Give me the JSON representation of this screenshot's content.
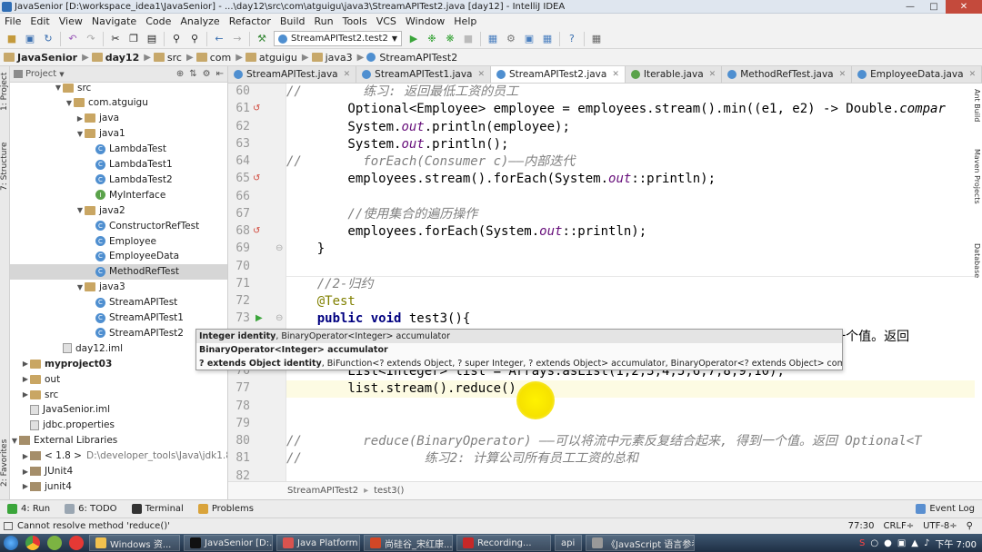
{
  "window": {
    "title": "JavaSenior [D:\\workspace_idea1\\JavaSenior] - ...\\day12\\src\\com\\atguigu\\java3\\StreamAPITest2.java [day12] - IntelliJ IDEA"
  },
  "menu": [
    "File",
    "Edit",
    "View",
    "Navigate",
    "Code",
    "Analyze",
    "Refactor",
    "Build",
    "Run",
    "Tools",
    "VCS",
    "Window",
    "Help"
  ],
  "toolbar": {
    "run_config": "StreamAPITest2.test2"
  },
  "breadcrumbs": [
    "JavaSenior",
    "day12",
    "src",
    "com",
    "atguigu",
    "java3",
    "StreamAPITest2"
  ],
  "project_panel": {
    "title": "Project",
    "tree": [
      {
        "label": "src",
        "level": 5
      },
      {
        "label": "com.atguigu",
        "level": 6
      },
      {
        "label": "java",
        "level": 7
      },
      {
        "label": "java1",
        "level": 7
      },
      {
        "label": "LambdaTest",
        "level": 8,
        "kind": "class"
      },
      {
        "label": "LambdaTest1",
        "level": 8,
        "kind": "class"
      },
      {
        "label": "LambdaTest2",
        "level": 8,
        "kind": "class"
      },
      {
        "label": "MyInterface",
        "level": 8,
        "kind": "interface"
      },
      {
        "label": "java2",
        "level": 7
      },
      {
        "label": "ConstructorRefTest",
        "level": 8,
        "kind": "class"
      },
      {
        "label": "Employee",
        "level": 8,
        "kind": "class"
      },
      {
        "label": "EmployeeData",
        "level": 8,
        "kind": "class"
      },
      {
        "label": "MethodRefTest",
        "level": 8,
        "kind": "class",
        "selected": true
      },
      {
        "label": "java3",
        "level": 7
      },
      {
        "label": "StreamAPITest",
        "level": 8,
        "kind": "class"
      },
      {
        "label": "StreamAPITest1",
        "level": 8,
        "kind": "class"
      },
      {
        "label": "StreamAPITest2",
        "level": 8,
        "kind": "class"
      },
      {
        "label": "day12.iml",
        "level": 5,
        "kind": "iml"
      },
      {
        "label": "myproject03",
        "level": 2,
        "kind": "module"
      },
      {
        "label": "out",
        "level": 2,
        "kind": "folder"
      },
      {
        "label": "src",
        "level": 2,
        "kind": "folder"
      },
      {
        "label": "JavaSenior.iml",
        "level": 2,
        "kind": "iml"
      },
      {
        "label": "jdbc.properties",
        "level": 2,
        "kind": "props"
      },
      {
        "label": "External Libraries",
        "level": 1,
        "kind": "lib"
      },
      {
        "label": "< 1.8 >",
        "level": 2,
        "kind": "lib",
        "path": "D:\\developer_tools\\Java\\jdk1.8.0"
      },
      {
        "label": "JUnit4",
        "level": 2,
        "kind": "lib"
      },
      {
        "label": "junit4",
        "level": 2,
        "kind": "lib"
      }
    ]
  },
  "editor_tabs": [
    {
      "label": "StreamAPITest.java"
    },
    {
      "label": "StreamAPITest1.java"
    },
    {
      "label": "StreamAPITest2.java",
      "active": true
    },
    {
      "label": "Iterable.java"
    },
    {
      "label": "MethodRefTest.java"
    },
    {
      "label": "EmployeeData.java"
    }
  ],
  "code_lines": [
    {
      "n": "60",
      "text": "//        练习: 返回最低工资的员工"
    },
    {
      "n": "61",
      "text": "        Optional<Employee> employee = employees.stream().min((e1, e2) -> Double.compar"
    },
    {
      "n": "62",
      "text": "        System.out.println(employee);"
    },
    {
      "n": "63",
      "text": "        System.out.println();"
    },
    {
      "n": "64",
      "text": "//        forEach(Consumer c)——内部迭代"
    },
    {
      "n": "65",
      "text": "        employees.stream().forEach(System.out::println);"
    },
    {
      "n": "66",
      "text": ""
    },
    {
      "n": "67",
      "text": "        //使用集合的遍历操作"
    },
    {
      "n": "68",
      "text": "        employees.forEach(System.out::println);"
    },
    {
      "n": "69",
      "text": "    }"
    },
    {
      "n": "70",
      "text": ""
    },
    {
      "n": "71",
      "text": "    //2-归约"
    },
    {
      "n": "72",
      "text": "    @Test"
    },
    {
      "n": "73",
      "text": "    public void test3(){"
    },
    {
      "n": "74",
      "text": "                                                                  , 得到一个值。返回"
    },
    {
      "n": "75",
      "text": ""
    },
    {
      "n": "76",
      "text": "        List<Integer> list = Arrays.asList(1,2,3,4,5,6,7,8,9,10);"
    },
    {
      "n": "77",
      "text": "        list.stream().reduce()"
    },
    {
      "n": "78",
      "text": ""
    },
    {
      "n": "79",
      "text": ""
    },
    {
      "n": "80",
      "text": "//        reduce(BinaryOperator) ——可以将流中元素反复结合起来, 得到一个值。返回 Optional<T"
    },
    {
      "n": "81",
      "text": "//                练习2: 计算公司所有员工工资的总和"
    },
    {
      "n": "82",
      "text": ""
    }
  ],
  "completion_popup": [
    {
      "bold": "Integer identity",
      "rest": ", BinaryOperator<Integer> accumulator"
    },
    {
      "bold": "BinaryOperator<Integer> accumulator",
      "rest": ""
    },
    {
      "bold": "? extends Object identity",
      "rest": ", BiFunction<? extends Object, ? super Integer, ? extends Object> accumulator, BinaryOperator<? extends Object> combiner"
    }
  ],
  "editor_breadcrumb": [
    "StreamAPITest2",
    "test3()"
  ],
  "bottom_tabs": [
    {
      "label": "4: Run"
    },
    {
      "label": "6: TODO"
    },
    {
      "label": "Terminal"
    },
    {
      "label": "Problems"
    }
  ],
  "event_log": "Event Log",
  "status": {
    "message": "Cannot resolve method 'reduce()'",
    "position": "77:30",
    "line_sep": "CRLF÷",
    "encoding": "UTF-8÷"
  },
  "ime": "英",
  "side_labels": {
    "project": "1: Project",
    "structure": "7: Structure",
    "favorites": "2: Favorites",
    "ant": "Ant Build",
    "maven": "Maven Projects",
    "database": "Database"
  },
  "taskbar": {
    "items": [
      "Windows 资...",
      "JavaSenior [D:...",
      "Java Platform ...",
      "尚硅谷_宋红康...",
      "Recording...",
      "api",
      "《JavaScript 语言参考..."
    ],
    "time": "下午 7:00"
  },
  "colors": {
    "comment": "#808080",
    "keyword": "#000080",
    "static_field": "#660e7a",
    "annotation": "#808000",
    "cursor_highlight": "#f6e200"
  }
}
